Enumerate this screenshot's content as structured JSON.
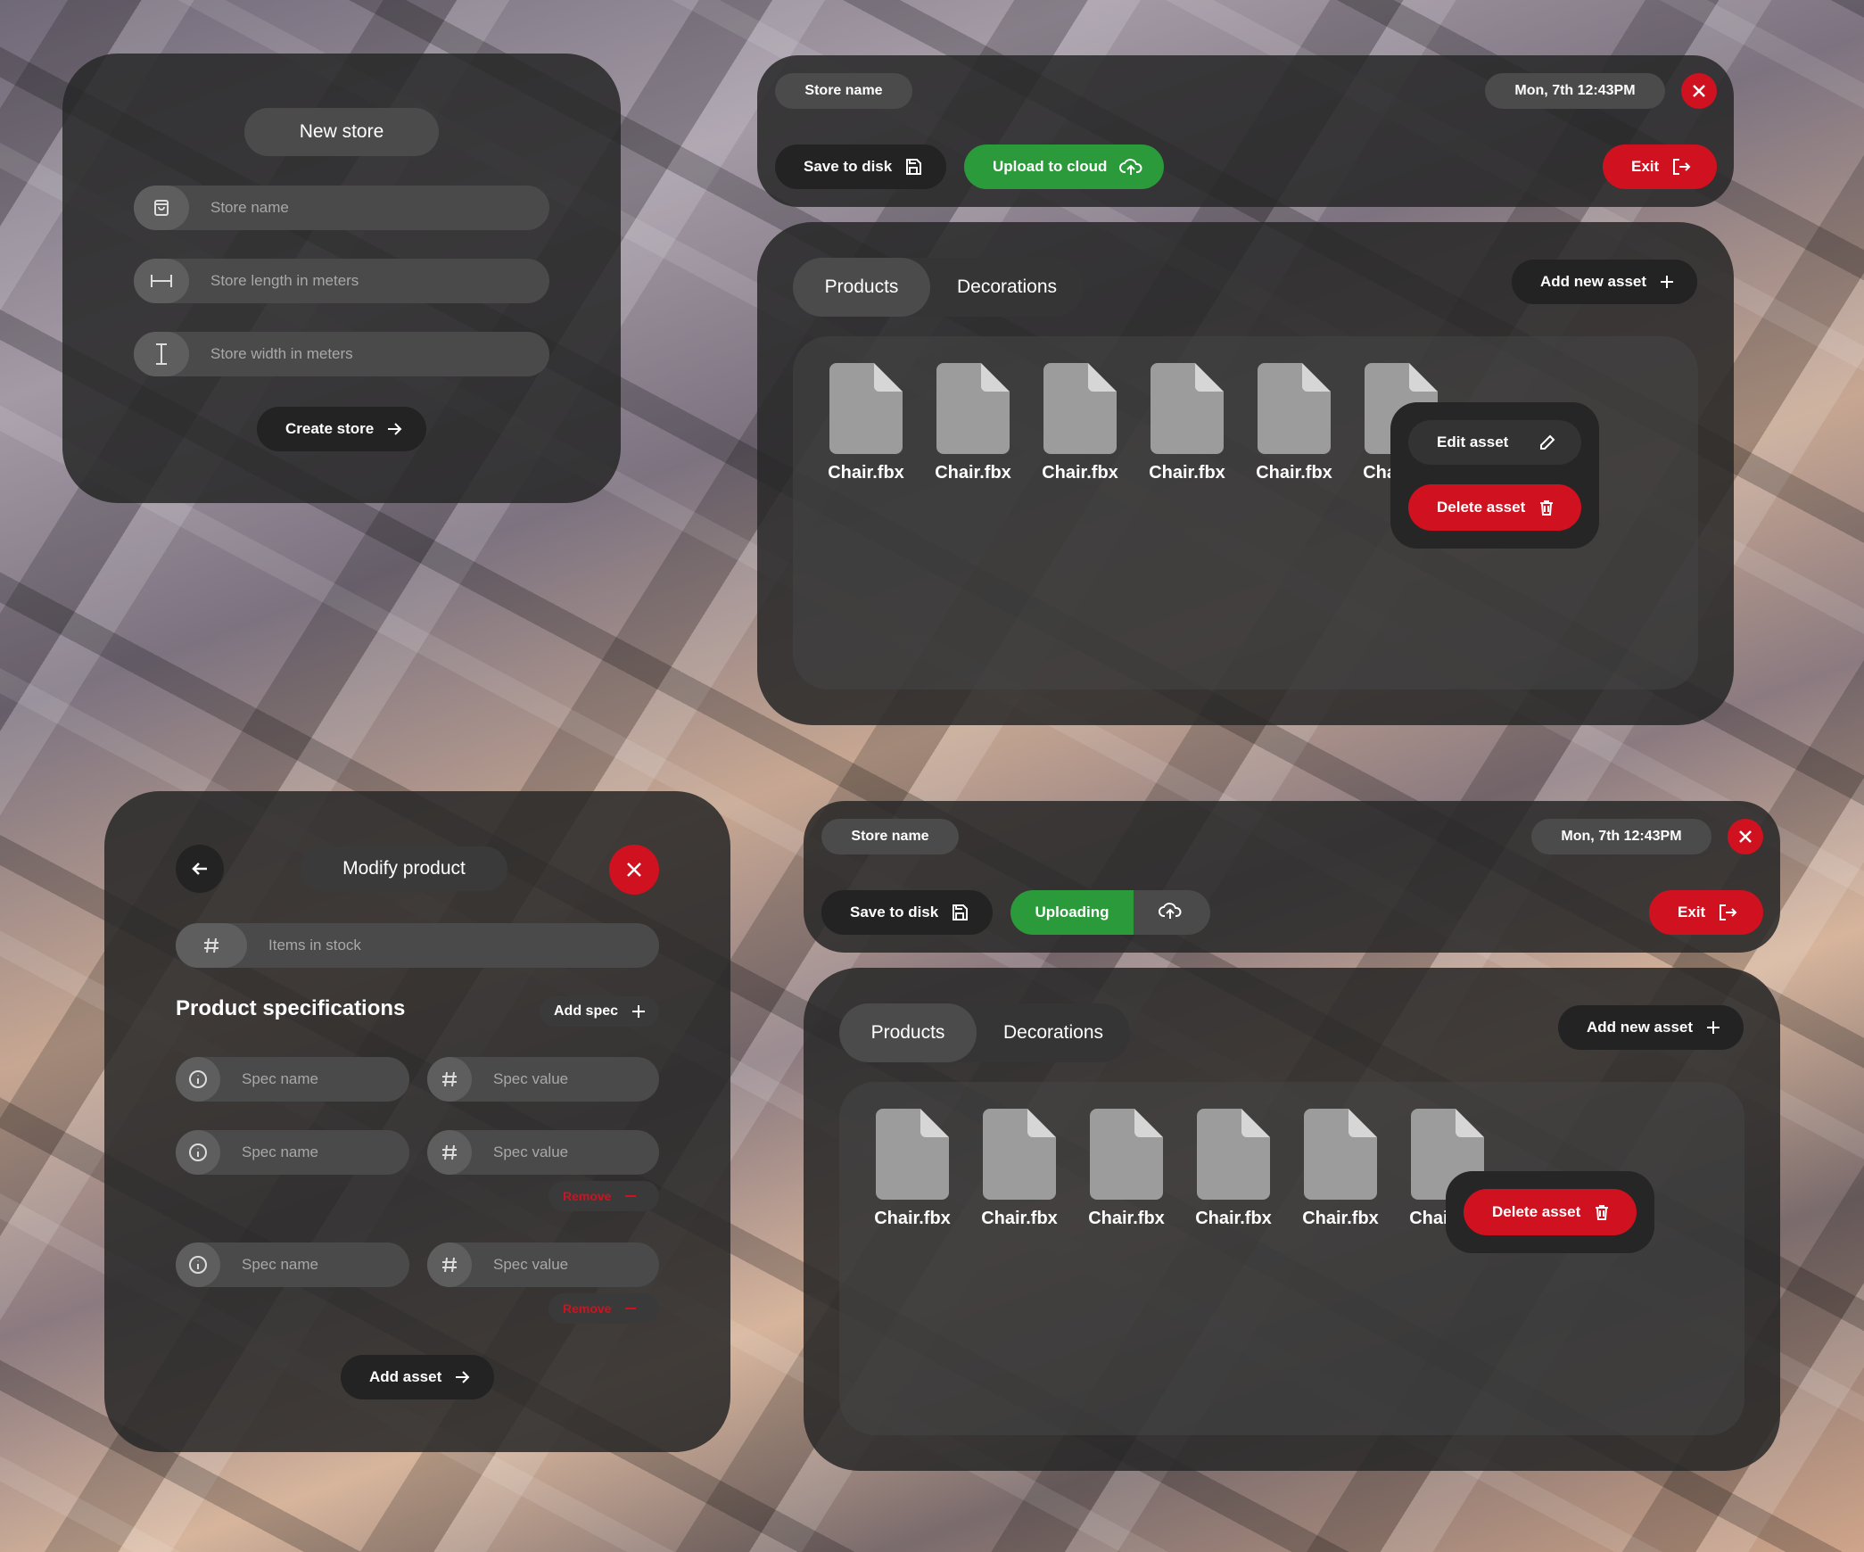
{
  "new_store": {
    "title": "New store",
    "fields": [
      {
        "placeholder": "Store name",
        "icon": "bag-icon"
      },
      {
        "placeholder": "Store length in meters",
        "icon": "length-icon"
      },
      {
        "placeholder": "Store width in meters",
        "icon": "width-icon"
      }
    ],
    "create_label": "Create store"
  },
  "editor1": {
    "store_name": "Store name",
    "datetime": "Mon, 7th 12:43PM",
    "save_label": "Save to disk",
    "upload_label": "Upload to cloud",
    "exit_label": "Exit",
    "tabs": [
      "Products",
      "Decorations"
    ],
    "add_asset_label": "Add new asset",
    "files": [
      "Chair.fbx",
      "Chair.fbx",
      "Chair.fbx",
      "Chair.fbx",
      "Chair.fbx",
      "Chair.fbx"
    ],
    "context_menu": {
      "edit_label": "Edit asset",
      "delete_label": "Delete asset"
    }
  },
  "modify_product": {
    "title": "Modify product",
    "stock_placeholder": "Items in stock",
    "specs_heading": "Product specifications",
    "add_spec_label": "Add spec",
    "spec_name_placeholder": "Spec name",
    "spec_value_placeholder": "Spec value",
    "remove_label": "Remove",
    "add_asset_label": "Add asset"
  },
  "editor2": {
    "store_name": "Store name",
    "datetime": "Mon, 7th 12:43PM",
    "save_label": "Save to disk",
    "uploading_label": "Uploading",
    "exit_label": "Exit",
    "tabs": [
      "Products",
      "Decorations"
    ],
    "add_asset_label": "Add new asset",
    "files": [
      "Chair.fbx",
      "Chair.fbx",
      "Chair.fbx",
      "Chair.fbx",
      "Chair.fbx",
      "Chair.fbx"
    ],
    "context_menu": {
      "delete_label": "Delete asset"
    }
  },
  "colors": {
    "accent_red": "#d0111f",
    "accent_green": "#2a9a3a",
    "panel": "#2a2a2a"
  }
}
